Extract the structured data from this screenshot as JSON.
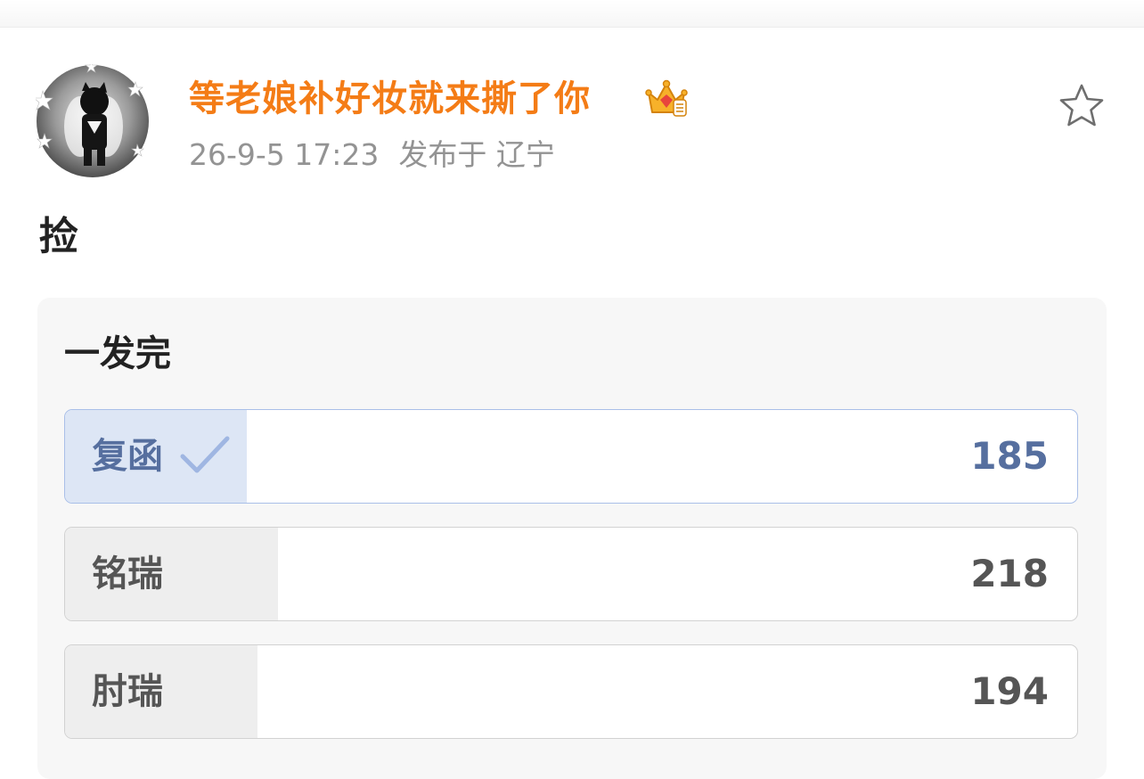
{
  "post": {
    "username": "等老娘补好妆就来撕了你",
    "badge_icon": "crown-icon",
    "timestamp": "26-9-5 17:23",
    "location": "发布于 辽宁",
    "text": "捡",
    "favorite_icon": "star-icon"
  },
  "poll": {
    "title": "一发完",
    "options": [
      {
        "label": "复函",
        "count": "185",
        "voted": true,
        "share": 0.18
      },
      {
        "label": "铭瑞",
        "count": "218",
        "voted": false,
        "share": 0.21
      },
      {
        "label": "肘瑞",
        "count": "194",
        "voted": false,
        "share": 0.19
      }
    ]
  },
  "colors": {
    "username": "#f47c16",
    "voted_fill": "#dde6f5",
    "voted_text": "#566f9f",
    "option_fill": "#eeeeee"
  }
}
